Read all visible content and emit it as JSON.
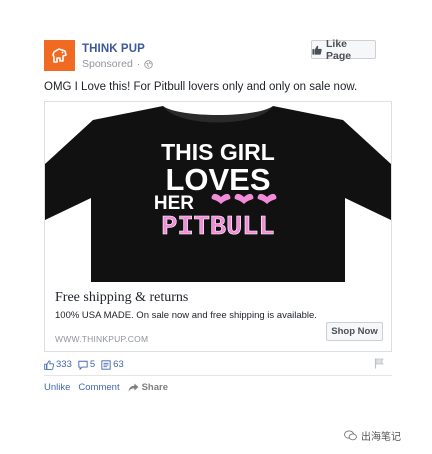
{
  "post": {
    "page_name": "THINK PUP",
    "sponsored_label": "Sponsored",
    "like_page_label": "Like Page",
    "text": "OMG I Love this! For Pitbull lovers only and only on sale now."
  },
  "ad": {
    "shirt_text": {
      "line1": "THIS GIRL",
      "line2": "LOVES",
      "line3": "HER",
      "line4": "PITBULL"
    },
    "headline": "Free shipping & returns",
    "description": "100% USA MADE. On sale now and free shipping is available.",
    "url": "WWW.THINKPUP.COM",
    "cta_label": "Shop Now"
  },
  "stats": {
    "likes": "333",
    "comments": "5",
    "shares": "63"
  },
  "actions": {
    "unlike": "Unlike",
    "comment": "Comment",
    "share": "Share"
  },
  "watermark": {
    "text": "出海笔记"
  },
  "colors": {
    "brand_orange": "#f16a21",
    "link_blue": "#4267b2",
    "page_name_blue": "#3b5998",
    "shirt_black": "#111111",
    "shirt_pink": "#f28bd8"
  }
}
